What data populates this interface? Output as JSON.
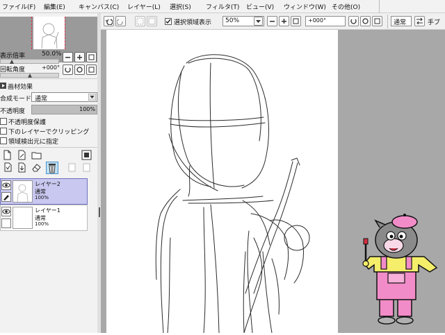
{
  "menubar": {
    "items": [
      {
        "label": "ファイル(F)"
      },
      {
        "label": "編集(E)"
      },
      {
        "label": "キャンバス(C)"
      },
      {
        "label": "レイヤー(L)"
      },
      {
        "label": "選択(S)"
      },
      {
        "label": "フィルタ(T)"
      },
      {
        "label": "ビュー(V)"
      },
      {
        "label": "ウィンドウ(W)"
      },
      {
        "label": "その他(O)"
      }
    ]
  },
  "toolbar": {
    "selection_display_label": "選択領域表示",
    "selection_display_checked": true,
    "zoom_value": "50%",
    "rotation_value": "+000°",
    "blend_mode_label": "通常",
    "hand_shake_label": "手ブ"
  },
  "navigator": {
    "zoom_label": "表示倍率",
    "zoom_value": "50.0%",
    "rotation_label": "回転角度",
    "rotation_value": "+000°"
  },
  "material_effect": {
    "label": "画材効果"
  },
  "blending": {
    "mode_label": "合成モード",
    "mode_value": "通常",
    "opacity_label": "不透明度",
    "opacity_value": "100%"
  },
  "options": [
    {
      "label": "不透明度保護",
      "checked": false
    },
    {
      "label": "下のレイヤーでクリッピング",
      "checked": false
    },
    {
      "label": "領域検出元に指定",
      "checked": false
    }
  ],
  "layers": [
    {
      "name": "レイヤー2",
      "mode": "通常",
      "opacity": "100%",
      "selected": true
    },
    {
      "name": "レイヤー1",
      "mode": "通常",
      "opacity": "100%",
      "selected": false
    }
  ],
  "colors": {
    "selected_layer": "#c8c8f0",
    "canvas_gray": "#a8a8a8",
    "mascot_pink": "#f28cc8",
    "mascot_yellow": "#f4ee6a"
  }
}
